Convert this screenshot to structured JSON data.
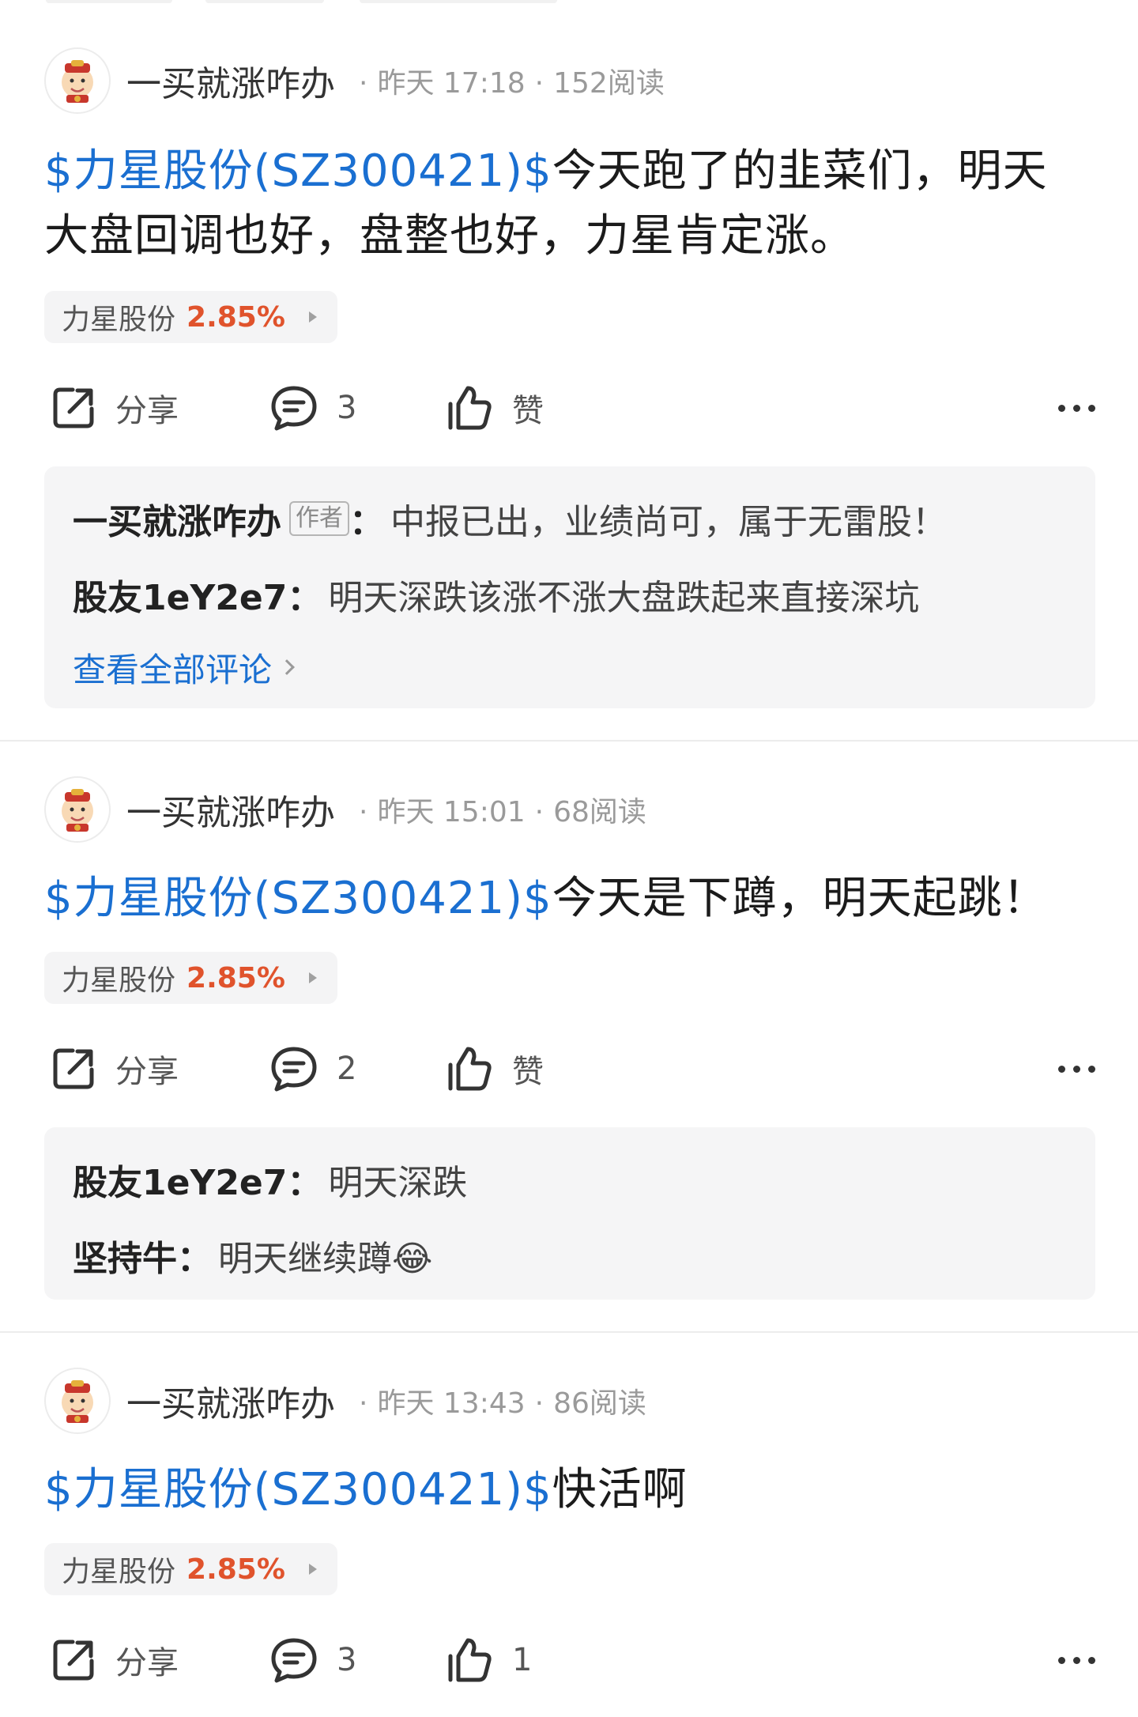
{
  "posts": [
    {
      "author": "一买就涨咋办",
      "time": "昨天 17:18",
      "reads": "152阅读",
      "tag": "$力星股份(SZ300421)$",
      "text_line1": "今天跑了的韭菜们，明天",
      "text_line2": "大盘回调也好，盘整也好，力星肯定涨。",
      "stock_name": "力星股份",
      "stock_pct": "2.85%",
      "share_label": "分享",
      "comment_count": "3",
      "like_label": "赞",
      "comments": [
        {
          "name": "一买就涨咋办",
          "badge": "作者",
          "text": "中报已出，业绩尚可，属于无雷股！"
        },
        {
          "name": "股友1eY2e7",
          "text": "明天深跌该涨不涨大盘跌起来直接深坑"
        }
      ],
      "view_all": "查看全部评论"
    },
    {
      "author": "一买就涨咋办",
      "time": "昨天 15:01",
      "reads": "68阅读",
      "tag": "$力星股份(SZ300421)$",
      "text_line1": "今天是下蹲，明天起跳！",
      "stock_name": "力星股份",
      "stock_pct": "2.85%",
      "share_label": "分享",
      "comment_count": "2",
      "like_label": "赞",
      "comments": [
        {
          "name": "股友1eY2e7",
          "text": "明天深跌"
        },
        {
          "name": "坚持牛",
          "text": "明天继续蹲😂"
        }
      ]
    },
    {
      "author": "一买就涨咋办",
      "time": "昨天 13:43",
      "reads": "86阅读",
      "tag": "$力星股份(SZ300421)$",
      "text_line1": "快活啊",
      "stock_name": "力星股份",
      "stock_pct": "2.85%",
      "share_label": "分享",
      "comment_count": "3",
      "like_count": "1"
    }
  ],
  "colors": {
    "link_blue": "#1a6fd1",
    "up_red": "#e0532c",
    "card_bg": "#f5f5f6"
  },
  "icons": [
    "avatar-icon",
    "share-icon",
    "comment-icon",
    "like-icon",
    "more-icon",
    "chevron-right-icon",
    "play-triangle-icon"
  ]
}
